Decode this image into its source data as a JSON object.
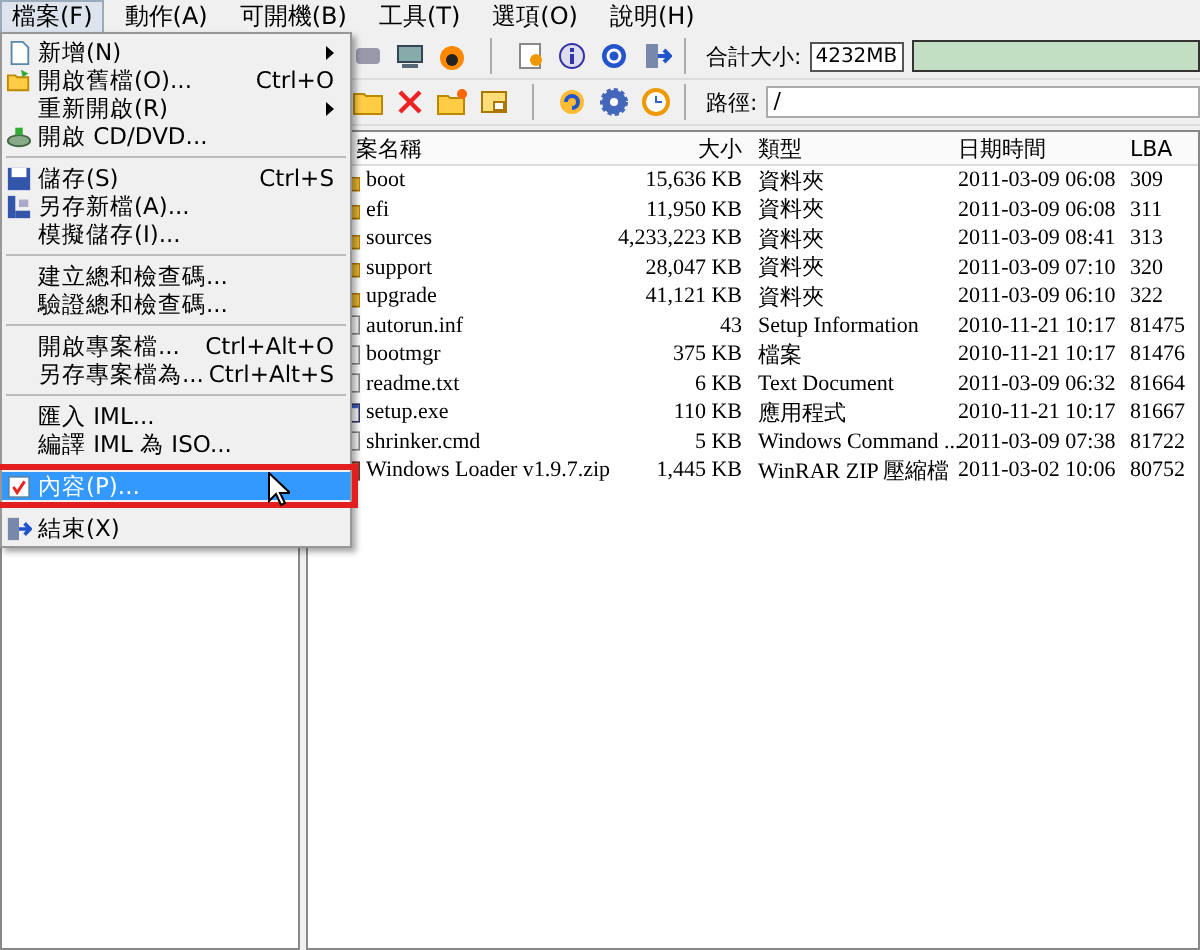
{
  "menubar": [
    {
      "label": "檔案(F)",
      "selected": true
    },
    {
      "label": "動作(A)",
      "selected": false
    },
    {
      "label": "可開機(B)",
      "selected": false
    },
    {
      "label": "工具(T)",
      "selected": false
    },
    {
      "label": "選項(O)",
      "selected": false
    },
    {
      "label": "說明(H)",
      "selected": false
    }
  ],
  "toolbar": {
    "total_label": "合計大小:",
    "total_value": "4232MB",
    "path_label": "路徑:",
    "path_value": "/"
  },
  "file_menu": [
    {
      "kind": "item",
      "label": "新增(N)",
      "submenu": true,
      "selected": false
    },
    {
      "kind": "item",
      "label": "開啟舊檔(O)...",
      "shortcut": "Ctrl+O",
      "selected": false
    },
    {
      "kind": "item",
      "label": "重新開啟(R)",
      "submenu": true,
      "selected": false
    },
    {
      "kind": "item",
      "label": "開啟 CD/DVD...",
      "selected": false
    },
    {
      "kind": "separator"
    },
    {
      "kind": "item",
      "label": "儲存(S)",
      "shortcut": "Ctrl+S",
      "selected": false
    },
    {
      "kind": "item",
      "label": "另存新檔(A)...",
      "selected": false
    },
    {
      "kind": "item",
      "label": "模擬儲存(I)...",
      "selected": false
    },
    {
      "kind": "separator"
    },
    {
      "kind": "item",
      "label": "建立總和檢查碼...",
      "selected": false
    },
    {
      "kind": "item",
      "label": "驗證總和檢查碼...",
      "selected": false
    },
    {
      "kind": "separator"
    },
    {
      "kind": "item",
      "label": "開啟專案檔...",
      "shortcut": "Ctrl+Alt+O",
      "selected": false
    },
    {
      "kind": "item",
      "label": "另存專案檔為...",
      "shortcut": "Ctrl+Alt+S",
      "selected": false
    },
    {
      "kind": "separator"
    },
    {
      "kind": "item",
      "label": "匯入 IML...",
      "selected": false
    },
    {
      "kind": "item",
      "label": "編譯 IML 為 ISO...",
      "selected": false
    },
    {
      "kind": "separator"
    },
    {
      "kind": "item",
      "label": "內容(P)...",
      "selected": true,
      "highlighted_box": true
    },
    {
      "kind": "separator"
    },
    {
      "kind": "item",
      "label": "結束(X)",
      "selected": false
    }
  ],
  "file_list": {
    "columns": [
      "案名稱",
      "大小",
      "類型",
      "日期時間",
      "LBA"
    ],
    "rows": [
      {
        "kind": "folder",
        "name": "boot",
        "size": "15,636 KB",
        "type": "資料夾",
        "date": "2011-03-09 06:08",
        "lba": "309"
      },
      {
        "kind": "folder",
        "name": "efi",
        "size": "11,950 KB",
        "type": "資料夾",
        "date": "2011-03-09 06:08",
        "lba": "311"
      },
      {
        "kind": "folder",
        "name": "sources",
        "size": "4,233,223 KB",
        "type": "資料夾",
        "date": "2011-03-09 08:41",
        "lba": "313"
      },
      {
        "kind": "folder",
        "name": "support",
        "size": "28,047 KB",
        "type": "資料夾",
        "date": "2011-03-09 07:10",
        "lba": "320"
      },
      {
        "kind": "folder",
        "name": "upgrade",
        "size": "41,121 KB",
        "type": "資料夾",
        "date": "2011-03-09 06:10",
        "lba": "322"
      },
      {
        "kind": "file",
        "name": "autorun.inf",
        "size": "43",
        "type": "Setup Information",
        "date": "2010-11-21 10:17",
        "lba": "81475"
      },
      {
        "kind": "file",
        "name": "bootmgr",
        "size": "375 KB",
        "type": "檔案",
        "date": "2010-11-21 10:17",
        "lba": "81476"
      },
      {
        "kind": "file",
        "name": "readme.txt",
        "size": "6 KB",
        "type": "Text Document",
        "date": "2011-03-09 06:32",
        "lba": "81664"
      },
      {
        "kind": "app",
        "name": "setup.exe",
        "size": "110 KB",
        "type": "應用程式",
        "date": "2010-11-21 10:17",
        "lba": "81667"
      },
      {
        "kind": "file",
        "name": "shrinker.cmd",
        "size": "5 KB",
        "type": "Windows Command ...",
        "date": "2011-03-09 07:38",
        "lba": "81722"
      },
      {
        "kind": "archive",
        "name": "Windows Loader v1.9.7.zip",
        "size": "1,445 KB",
        "type": "WinRAR ZIP 壓縮檔",
        "date": "2011-03-02 10:06",
        "lba": "80752"
      }
    ]
  }
}
